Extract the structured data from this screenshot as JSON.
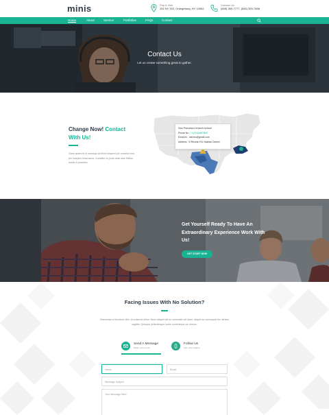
{
  "header": {
    "logo": "minis",
    "visit": {
      "label": "Pay A Visit",
      "value": "252 NY 303, Orangeburg, NY 10962"
    },
    "contact": {
      "label": "Contact Us",
      "value": "(845) 359-7777, (845) 359-7668"
    },
    "icons": {
      "location": "map-pin-icon",
      "phone": "phone-icon",
      "search": "search-icon"
    }
  },
  "nav": {
    "items": [
      "Home",
      "About",
      "Service",
      "Portfolios",
      "FAQs",
      "Contact"
    ],
    "active": "Home"
  },
  "hero": {
    "title": "Contact Us",
    "subtitle": "Let us create something great to gather."
  },
  "change": {
    "title_prefix": "Change Now!",
    "title_accent": "Contact",
    "title_accent2": "With Us!",
    "body": "Class aptent ta iti sociosqu ad litora torquent per conubia nost, per inceptos himenaeos. Curabitur eu justo vitae ante finibus iaculis in pharetra."
  },
  "map": {
    "card_title": "San Francisco branch school",
    "phone_label": "Phone No :",
    "phone_value": "+1(234)4567890",
    "email_label": "Email ex :",
    "email_value": "minimo@gmail.com",
    "address_label": "Address :",
    "address_value": "5 Rhizvan Rd, Nashan District"
  },
  "band": {
    "title": "Get Yourself Ready To Have An Extraordinary Experience Work With Us!",
    "button": "GET START NOW"
  },
  "faq": {
    "title": "Facing Issues With No Solution?",
    "body": "Maecenas ut tincidunt nibh, at euismod tellus. Nunc aliquet elit eu venenatis vel diam, aliquet ac consequat leo ultrices sagittis. Quisque pellentesque lorem scelerisque vel dictum.",
    "tabs": [
      {
        "label": "Send A Message",
        "sub": "Mallet viverra odio"
      },
      {
        "label": "Follow Us",
        "sub": "Sam vitae dragne"
      }
    ]
  },
  "form": {
    "name_placeholder": "Name",
    "email_placeholder": "Email",
    "subject_placeholder": "Message Subject",
    "message_placeholder": "Your Message Here"
  },
  "colors": {
    "accent": "#19b394",
    "dark": "#2c3a47"
  }
}
